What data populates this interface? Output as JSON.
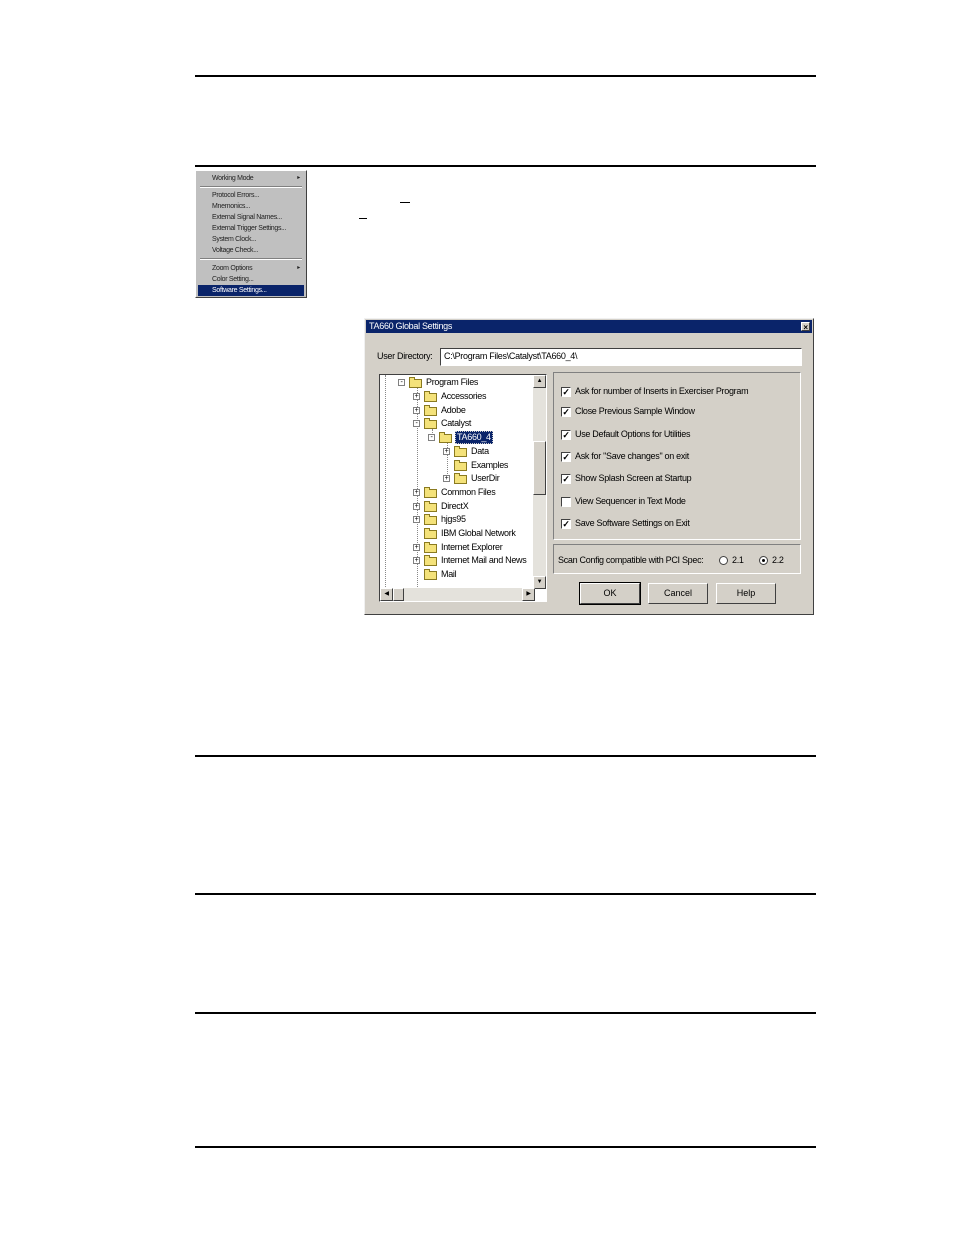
{
  "menu": {
    "items": [
      {
        "label": "Working Mode",
        "submenu": true
      },
      {
        "label": "Protocol Errors..."
      },
      {
        "label": "Mnemonics..."
      },
      {
        "label": "External Signal Names..."
      },
      {
        "label": "External Trigger Settings..."
      },
      {
        "label": "System Clock..."
      },
      {
        "label": "Voltage Check..."
      },
      {
        "label": "Zoom Options",
        "submenu": true
      },
      {
        "label": "Color Setting..."
      },
      {
        "label": "Software Settings...",
        "selected": true
      }
    ],
    "submenu_glyph": "▸"
  },
  "dialog": {
    "title": "TA660 Global Settings",
    "close_glyph": "×",
    "user_directory_label": "User Directory:",
    "user_directory_value": "C:\\Program Files\\Catalyst\\TA660_4\\",
    "tree": [
      {
        "label": "Program Files",
        "toggle": "-"
      },
      {
        "label": "Accessories",
        "toggle": "+"
      },
      {
        "label": "Adobe",
        "toggle": "+"
      },
      {
        "label": "Catalyst",
        "toggle": "-"
      },
      {
        "label": "TA660_4",
        "toggle": "-",
        "selected": true
      },
      {
        "label": "Data",
        "toggle": "+"
      },
      {
        "label": "Examples",
        "toggle": ""
      },
      {
        "label": "UserDir",
        "toggle": "+"
      },
      {
        "label": "Common Files",
        "toggle": "+"
      },
      {
        "label": "DirectX",
        "toggle": "+"
      },
      {
        "label": "hjgs95",
        "toggle": "+"
      },
      {
        "label": "IBM Global Network",
        "toggle": ""
      },
      {
        "label": "Internet Explorer",
        "toggle": "+"
      },
      {
        "label": "Internet Mail and News",
        "toggle": "+"
      },
      {
        "label": "Mail",
        "toggle": ""
      }
    ],
    "scroll_glyphs": {
      "up": "▲",
      "down": "▼",
      "left": "◀",
      "right": "▶"
    },
    "options": [
      {
        "label": "Ask for number of Inserts in Exerciser Program",
        "checked": true
      },
      {
        "label": "Close Previous Sample Window",
        "checked": true
      },
      {
        "label": "Use Default Options for Utilities",
        "checked": true
      },
      {
        "label": "Ask for \"Save changes\" on exit",
        "checked": true
      },
      {
        "label": "Show Splash Screen at Startup",
        "checked": true
      },
      {
        "label": "View Sequencer in Text Mode",
        "checked": false
      },
      {
        "label": "Save Software Settings on Exit",
        "checked": true
      }
    ],
    "check_glyph": "✓",
    "pci_spec_label": "Scan Config compatible with PCI Spec:",
    "pci_options": [
      {
        "label": "2.1",
        "selected": false
      },
      {
        "label": "2.2",
        "selected": true
      }
    ],
    "buttons": {
      "ok": "OK",
      "cancel": "Cancel",
      "help": "Help"
    }
  },
  "colors": {
    "selection": "#0a246a",
    "dialog_face": "#d4d0c8",
    "folder": "#f4e27a"
  }
}
